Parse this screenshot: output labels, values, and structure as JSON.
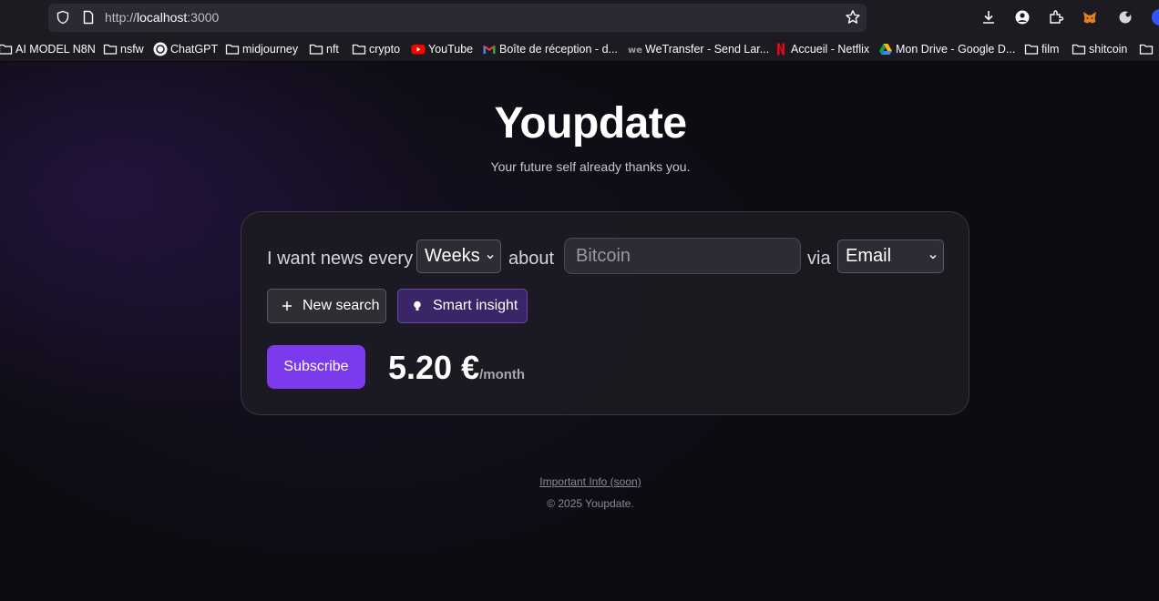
{
  "browser": {
    "url_scheme": "http://",
    "url_host": "localhost",
    "url_port": ":3000",
    "bookmarks": [
      {
        "label": "AI MODEL N8N",
        "icon": "folder-icon"
      },
      {
        "label": "nsfw",
        "icon": "folder-icon"
      },
      {
        "label": "ChatGPT",
        "icon": "chatgpt-icon"
      },
      {
        "label": "midjourney",
        "icon": "folder-icon"
      },
      {
        "label": "nft",
        "icon": "folder-icon"
      },
      {
        "label": "crypto",
        "icon": "folder-icon"
      },
      {
        "label": "YouTube",
        "icon": "youtube-icon"
      },
      {
        "label": "Boîte de réception - d...",
        "icon": "gmail-icon"
      },
      {
        "label": "WeTransfer - Send Lar...",
        "icon": "wetransfer-icon"
      },
      {
        "label": "Accueil - Netflix",
        "icon": "netflix-icon"
      },
      {
        "label": "Mon Drive - Google D...",
        "icon": "google-drive-icon"
      },
      {
        "label": "film",
        "icon": "folder-icon"
      },
      {
        "label": "shitcoin",
        "icon": "folder-icon"
      }
    ]
  },
  "header": {
    "title": "Youpdate",
    "subtitle": "Your future self already thanks you."
  },
  "form": {
    "prefix": "I want news every",
    "frequency": "Weeks",
    "about_label": "about",
    "topic_placeholder": "Bitcoin",
    "via_label": "via",
    "channel": "Email",
    "new_search_label": "New search",
    "smart_insight_label": "Smart insight",
    "subscribe_label": "Subscribe",
    "price": "5.20 €",
    "price_period": "/month"
  },
  "footer": {
    "info_link": "Important Info (soon)",
    "copyright": "© 2025 Youpdate."
  },
  "colors": {
    "accent": "#7c3aed",
    "background": "#0d0c11",
    "card": "#1c1a22"
  }
}
